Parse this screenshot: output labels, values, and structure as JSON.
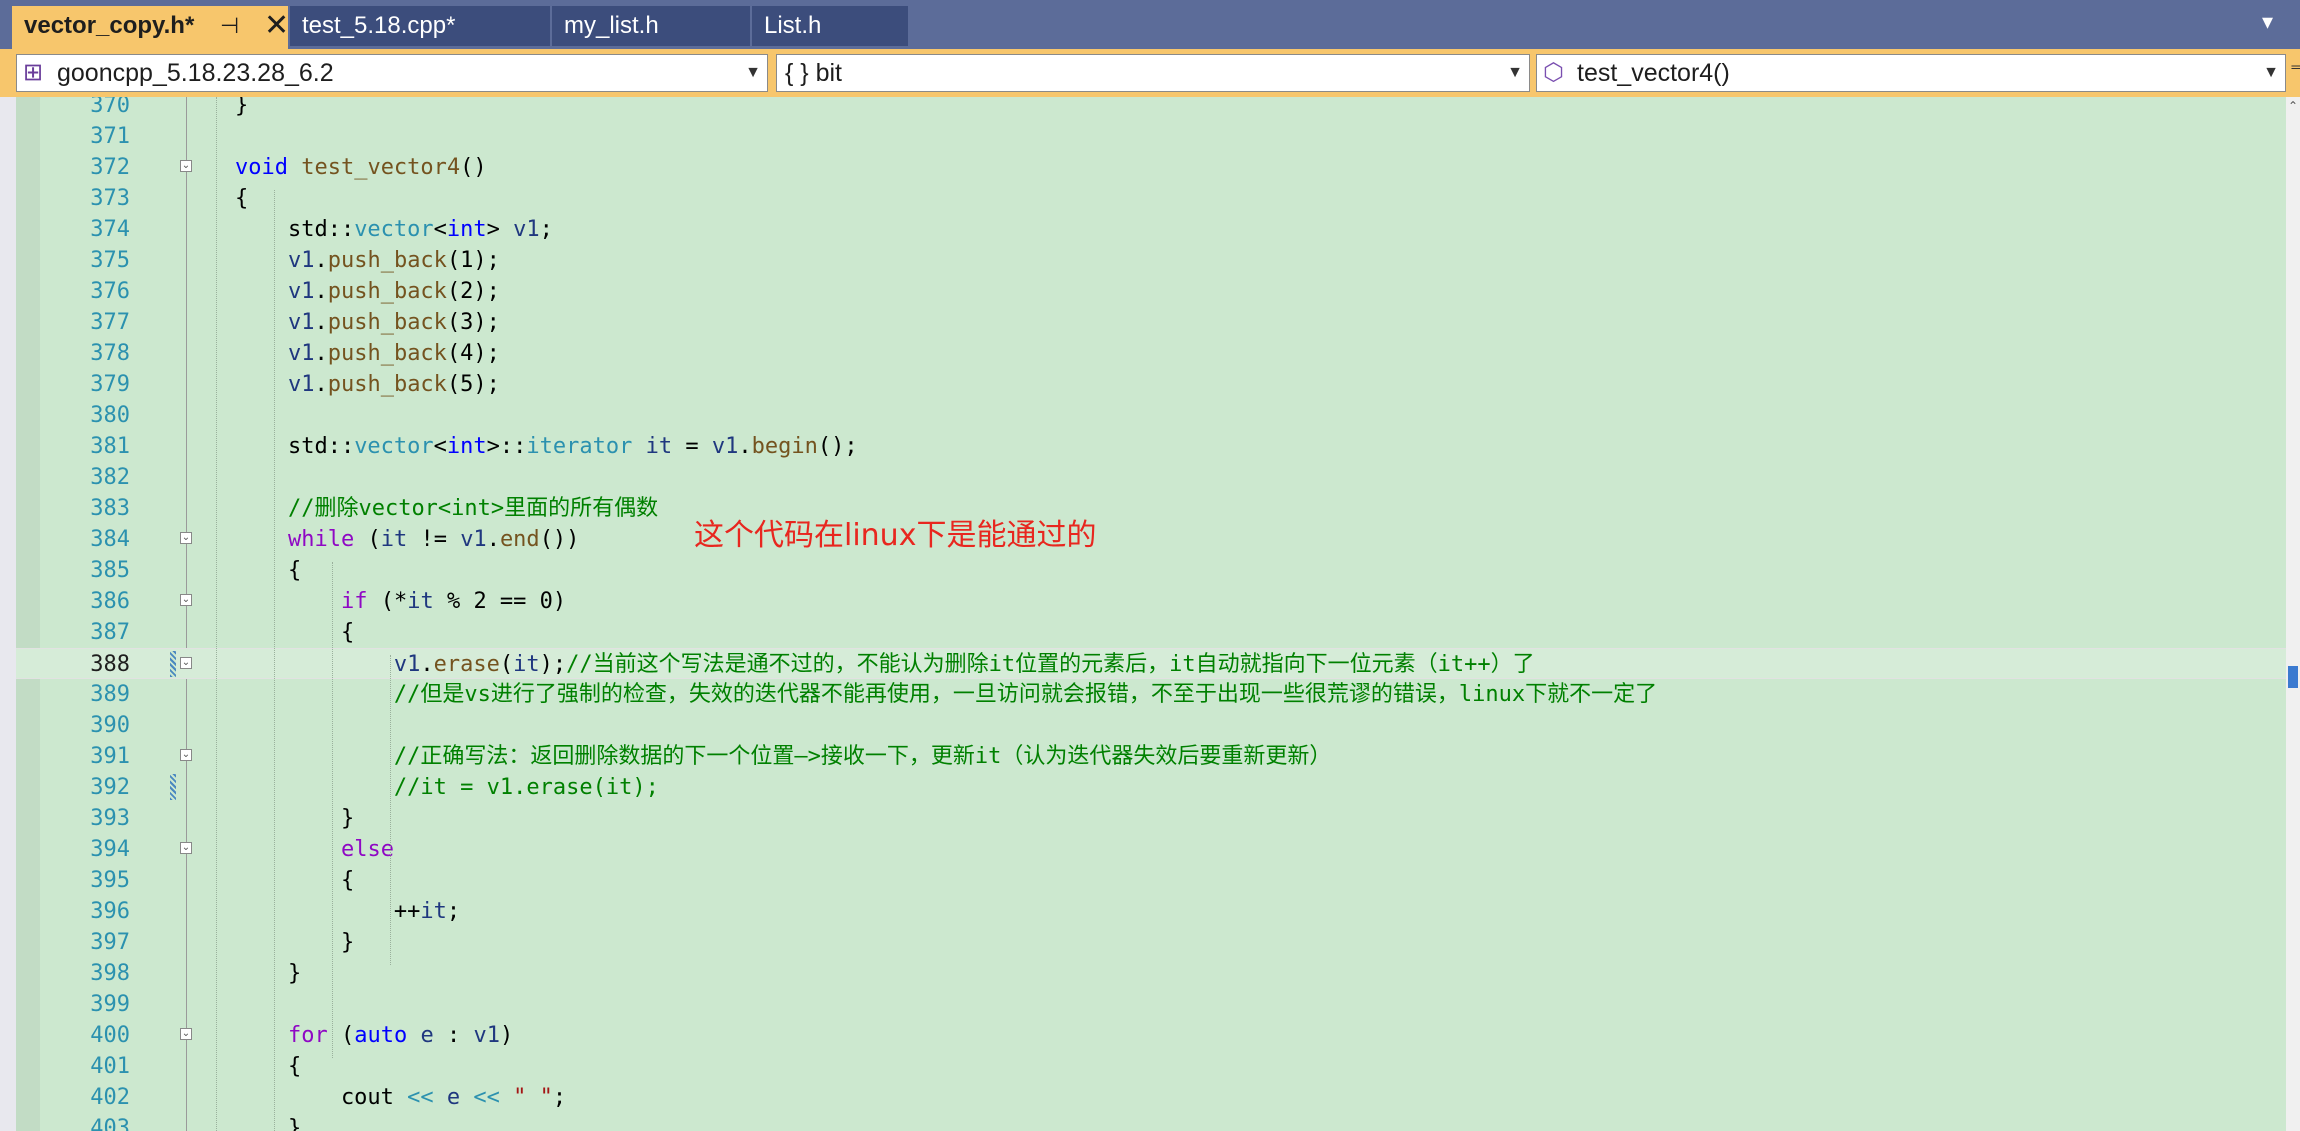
{
  "tabs": [
    {
      "label": "vector_copy.h*",
      "active": true,
      "pin": "⊣",
      "close": "✕"
    },
    {
      "label": "test_5.18.cpp*",
      "active": false
    },
    {
      "label": "my_list.h",
      "active": false
    },
    {
      "label": "List.h",
      "active": false
    }
  ],
  "navbar": {
    "project": "gooncpp_5.18.23.28_6.2",
    "scope": "{ } bit",
    "member": "test_vector4()"
  },
  "annotation": "这个代码在linux下是能通过的",
  "colors": {
    "editor_bg": "#cce8cf",
    "active_tab": "#f7c66c",
    "keyword": "#0000ff",
    "comment": "#008000",
    "line_number": "#2b91af",
    "annotation": "#e8271f"
  },
  "current_line": 388,
  "lines": [
    {
      "n": 370,
      "t": [
        [
          "",
          "    }"
        ]
      ]
    },
    {
      "n": 371,
      "t": []
    },
    {
      "n": 372,
      "fold": true,
      "t": [
        [
          "",
          "    "
        ],
        [
          "kw",
          "void"
        ],
        [
          "",
          " "
        ],
        [
          "fn",
          "test_vector4"
        ],
        [
          "",
          "()"
        ]
      ]
    },
    {
      "n": 373,
      "t": [
        [
          "",
          "    {"
        ]
      ]
    },
    {
      "n": 374,
      "t": [
        [
          "",
          "        std::"
        ],
        [
          "typ",
          "vector"
        ],
        [
          "",
          "<"
        ],
        [
          "kw",
          "int"
        ],
        [
          "",
          "> "
        ],
        [
          "var",
          "v1"
        ],
        [
          "",
          ";"
        ]
      ]
    },
    {
      "n": 375,
      "t": [
        [
          "",
          "        "
        ],
        [
          "var",
          "v1"
        ],
        [
          "",
          "."
        ],
        [
          "fn",
          "push_back"
        ],
        [
          "",
          "(1);"
        ]
      ]
    },
    {
      "n": 376,
      "t": [
        [
          "",
          "        "
        ],
        [
          "var",
          "v1"
        ],
        [
          "",
          "."
        ],
        [
          "fn",
          "push_back"
        ],
        [
          "",
          "(2);"
        ]
      ]
    },
    {
      "n": 377,
      "t": [
        [
          "",
          "        "
        ],
        [
          "var",
          "v1"
        ],
        [
          "",
          "."
        ],
        [
          "fn",
          "push_back"
        ],
        [
          "",
          "(3);"
        ]
      ]
    },
    {
      "n": 378,
      "t": [
        [
          "",
          "        "
        ],
        [
          "var",
          "v1"
        ],
        [
          "",
          "."
        ],
        [
          "fn",
          "push_back"
        ],
        [
          "",
          "(4);"
        ]
      ]
    },
    {
      "n": 379,
      "t": [
        [
          "",
          "        "
        ],
        [
          "var",
          "v1"
        ],
        [
          "",
          "."
        ],
        [
          "fn",
          "push_back"
        ],
        [
          "",
          "(5);"
        ]
      ]
    },
    {
      "n": 380,
      "t": []
    },
    {
      "n": 381,
      "t": [
        [
          "",
          "        std::"
        ],
        [
          "typ",
          "vector"
        ],
        [
          "",
          "<"
        ],
        [
          "kw",
          "int"
        ],
        [
          "",
          ">::"
        ],
        [
          "typ",
          "iterator"
        ],
        [
          "",
          " "
        ],
        [
          "var",
          "it"
        ],
        [
          "",
          " = "
        ],
        [
          "var",
          "v1"
        ],
        [
          "",
          "."
        ],
        [
          "fn",
          "begin"
        ],
        [
          "",
          "();"
        ]
      ]
    },
    {
      "n": 382,
      "t": []
    },
    {
      "n": 383,
      "t": [
        [
          "",
          "        "
        ],
        [
          "cm",
          "//删除vector<int>里面的所有偶数"
        ]
      ]
    },
    {
      "n": 384,
      "fold": true,
      "t": [
        [
          "",
          "        "
        ],
        [
          "ctl",
          "while"
        ],
        [
          "",
          " ("
        ],
        [
          "var",
          "it"
        ],
        [
          "",
          " != "
        ],
        [
          "var",
          "v1"
        ],
        [
          "",
          "."
        ],
        [
          "fn",
          "end"
        ],
        [
          "",
          "())"
        ]
      ]
    },
    {
      "n": 385,
      "t": [
        [
          "",
          "        {"
        ]
      ]
    },
    {
      "n": 386,
      "fold": true,
      "t": [
        [
          "",
          "            "
        ],
        [
          "ctl",
          "if"
        ],
        [
          "",
          " (*"
        ],
        [
          "var",
          "it"
        ],
        [
          "",
          " % 2 == 0)"
        ]
      ]
    },
    {
      "n": 387,
      "t": [
        [
          "",
          "            {"
        ]
      ]
    },
    {
      "n": 388,
      "fold": true,
      "change": true,
      "t": [
        [
          "",
          "                "
        ],
        [
          "var",
          "v1"
        ],
        [
          "",
          "."
        ],
        [
          "fn",
          "erase"
        ],
        [
          "",
          "("
        ],
        [
          "var",
          "it"
        ],
        [
          "",
          ");"
        ],
        [
          "cm",
          "//当前这个写法是通不过的，不能认为删除it位置的元素后，it自动就指向下一位元素（it++）了"
        ]
      ]
    },
    {
      "n": 389,
      "t": [
        [
          "",
          "                "
        ],
        [
          "cm",
          "//但是vs进行了强制的检查，失效的迭代器不能再使用，一旦访问就会报错，不至于出现一些很荒谬的错误，linux下就不一定了"
        ]
      ]
    },
    {
      "n": 390,
      "t": []
    },
    {
      "n": 391,
      "fold": true,
      "t": [
        [
          "",
          "                "
        ],
        [
          "cm",
          "//正确写法：返回删除数据的下一个位置—>接收一下，更新it（认为迭代器失效后要重新更新）"
        ]
      ]
    },
    {
      "n": 392,
      "change": true,
      "t": [
        [
          "",
          "                "
        ],
        [
          "cm",
          "//it = v1.erase(it);"
        ]
      ]
    },
    {
      "n": 393,
      "t": [
        [
          "",
          "            }"
        ]
      ]
    },
    {
      "n": 394,
      "fold": true,
      "t": [
        [
          "",
          "            "
        ],
        [
          "ctl",
          "else"
        ]
      ]
    },
    {
      "n": 395,
      "t": [
        [
          "",
          "            {"
        ]
      ]
    },
    {
      "n": 396,
      "t": [
        [
          "",
          "                ++"
        ],
        [
          "var",
          "it"
        ],
        [
          "",
          ";"
        ]
      ]
    },
    {
      "n": 397,
      "t": [
        [
          "",
          "            }"
        ]
      ]
    },
    {
      "n": 398,
      "t": [
        [
          "",
          "        }"
        ]
      ]
    },
    {
      "n": 399,
      "t": []
    },
    {
      "n": 400,
      "fold": true,
      "t": [
        [
          "",
          "        "
        ],
        [
          "ctl",
          "for"
        ],
        [
          "",
          " ("
        ],
        [
          "kw",
          "auto"
        ],
        [
          "",
          " "
        ],
        [
          "var",
          "e"
        ],
        [
          "",
          " : "
        ],
        [
          "var",
          "v1"
        ],
        [
          "",
          ")"
        ]
      ]
    },
    {
      "n": 401,
      "t": [
        [
          "",
          "        {"
        ]
      ]
    },
    {
      "n": 402,
      "t": [
        [
          "",
          "            cout "
        ],
        [
          "typ",
          "<<"
        ],
        [
          "",
          " "
        ],
        [
          "var",
          "e"
        ],
        [
          "",
          " "
        ],
        [
          "typ",
          "<<"
        ],
        [
          "",
          " "
        ],
        [
          "str",
          "\" \""
        ],
        [
          "",
          ";"
        ]
      ]
    },
    {
      "n": 403,
      "t": [
        [
          "",
          "        }"
        ]
      ]
    }
  ]
}
